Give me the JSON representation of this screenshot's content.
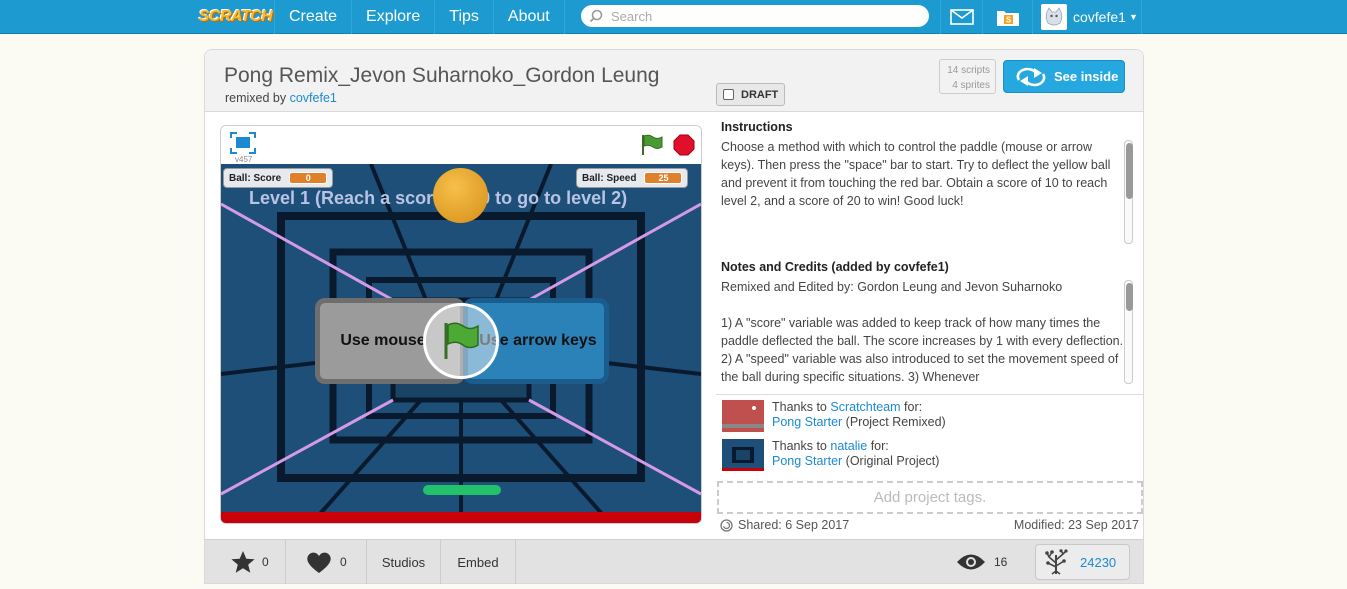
{
  "nav": {
    "logo": "SCRATCH",
    "items": [
      "Create",
      "Explore",
      "Tips",
      "About"
    ],
    "search_placeholder": "Search",
    "username": "covfefe1"
  },
  "project": {
    "title": "Pong Remix_Jevon Suharnoko_Gordon Leung",
    "remixed_prefix": "remixed by ",
    "remixed_user": "covfefe1",
    "draft_label": "DRAFT",
    "scripts_count": "14 scripts",
    "sprites_count": "4 sprites",
    "see_inside": "See inside"
  },
  "player": {
    "version": "v457",
    "score_label": "Ball: Score",
    "score_value": "0",
    "speed_label": "Ball: Speed",
    "speed_value": "25",
    "level_text": "Level 1 (Reach a score of 10 to go to level 2)",
    "mouse_button": "Use mouse",
    "arrow_button": "Use arrow keys"
  },
  "instructions": {
    "heading": "Instructions",
    "text": "Choose a method with which to control the paddle (mouse or arrow keys). Then press the \"space\" bar to start. Try to deflect the yellow ball and prevent it from touching the red bar. Obtain a score of 10 to reach level 2, and a score of 20 to win! Good luck!"
  },
  "notes": {
    "heading": "Notes and Credits (added by covfefe1)",
    "line1": "Remixed and Edited by: Gordon Leung and Jevon Suharnoko",
    "line2": "1) A \"score\" variable was added to keep track of how many times the paddle deflected the ball. The score increases by 1 with every deflection. 2) A \"speed\" variable was also introduced to set the movement speed of the ball during specific situations. 3) Whenever"
  },
  "credits": [
    {
      "prefix": "Thanks to ",
      "user": "Scratchteam",
      "suffix": " for:",
      "project": "Pong Starter",
      "note": " (Project Remixed)"
    },
    {
      "prefix": "Thanks to ",
      "user": "natalie",
      "suffix": " for:",
      "project": "Pong Starter",
      "note": " (Original Project)"
    }
  ],
  "tags_placeholder": "Add project tags.",
  "dates": {
    "shared": "Shared: 6 Sep 2017",
    "modified": "Modified: 23 Sep 2017"
  },
  "stats": {
    "favorites": "0",
    "loves": "0",
    "studios": "Studios",
    "embed": "Embed",
    "views": "16",
    "remixes": "24230"
  },
  "colors": {
    "nav_blue": "#1d9bd1",
    "link": "#1c8ad0",
    "red_bar": "#c8000a",
    "paddle": "#22c16a"
  }
}
